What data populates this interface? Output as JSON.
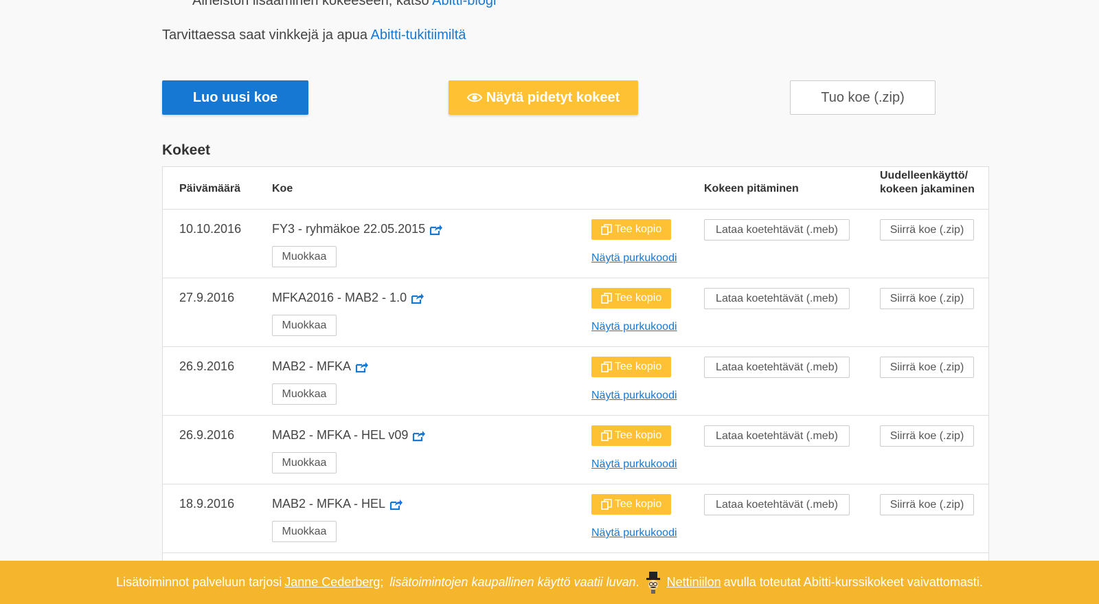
{
  "intro": {
    "top_text": "Aineiston lisääminen kokeeseen, katso",
    "top_link": "Abitti-blogi",
    "help_text": "Tarvittaessa saat vinkkejä ja apua",
    "help_link": "Abitti-tukitiimiltä"
  },
  "actions": {
    "create_label": "Luo uusi koe",
    "show_held_label": "Näytä pidetyt kokeet",
    "import_label": "Tuo koe (.zip)"
  },
  "section_title": "Kokeet",
  "table": {
    "headers": {
      "date": "Päivämäärä",
      "exam": "Koe",
      "holding": "Kokeen pitäminen",
      "reuse": "Uudelleenkäyttö/ kokeen jakaminen"
    },
    "rows": [
      {
        "date": "10.10.2016",
        "name": "FY3 - ryhmäkoe 22.05.2015"
      },
      {
        "date": "27.9.2016",
        "name": "MFKA2016 - MAB2 - 1.0"
      },
      {
        "date": "26.9.2016",
        "name": "MAB2 - MFKA"
      },
      {
        "date": "26.9.2016",
        "name": "MAB2 - MFKA - HEL v09"
      },
      {
        "date": "18.9.2016",
        "name": "MAB2 - MFKA - HEL"
      }
    ],
    "edit_label": "Muokkaa",
    "copy_label": "Tee kopio",
    "code_label": "Näytä purkukoodi",
    "download_label": "Lataa koetehtävät (.meb)",
    "transfer_label": "Siirrä koe (.zip)"
  },
  "footer": {
    "text1": "Lisätoiminnot palveluun tarjosi",
    "author": "Janne Cederberg",
    "text2": "; ",
    "italic": "lisätoimintojen kaupallinen käyttö vaatii luvan",
    "text3": ".",
    "link": "Nettiniilon",
    "text4": "avulla toteutat Abitti-kurssikokeet vaivattomasti."
  },
  "colors": {
    "primary": "#1778d4",
    "yellow": "#fec133",
    "footer": "#f5b62d"
  }
}
